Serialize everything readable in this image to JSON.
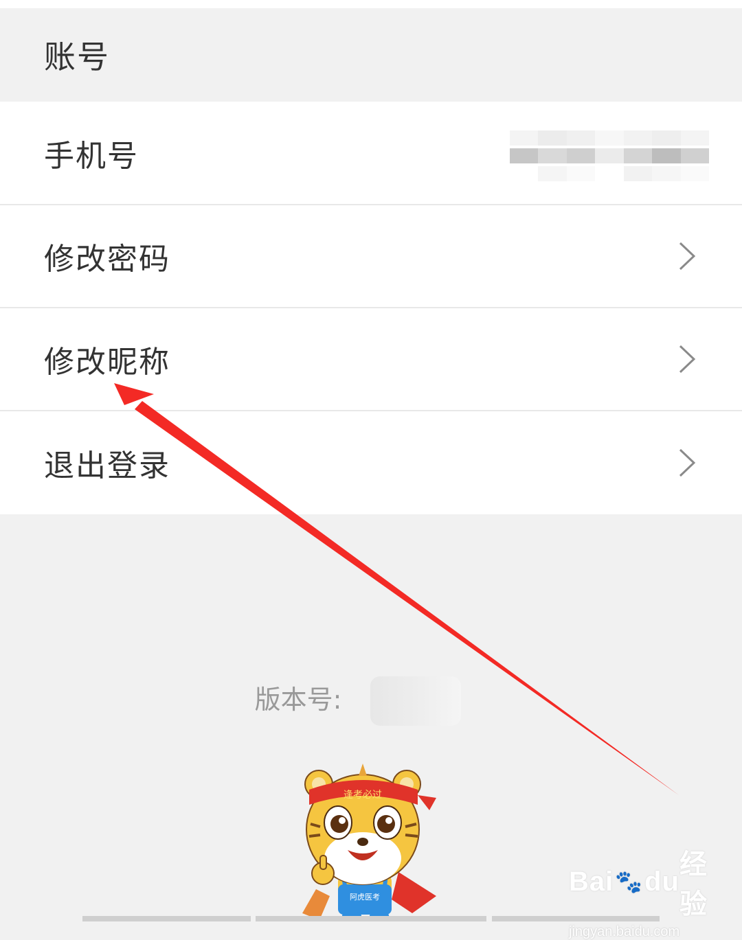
{
  "header": {
    "title": "账号"
  },
  "rows": [
    {
      "label": "手机号",
      "value": "",
      "has_chevron": false
    },
    {
      "label": "修改密码",
      "has_chevron": true
    },
    {
      "label": "修改昵称",
      "has_chevron": true
    },
    {
      "label": "退出登录",
      "has_chevron": true
    }
  ],
  "footer": {
    "version_label": "版本号:"
  },
  "mascot": {
    "headband_text": "逢考必过",
    "belly_text": "阿虎医考"
  },
  "watermark": {
    "brand": "Bai",
    "brand_suffix": "du",
    "product": "经验",
    "url": "jingyan.baidu.com"
  },
  "annotation": {
    "arrow_color": "#f32a25",
    "points_to": "修改昵称"
  },
  "icons": {
    "chevron": "chevron-right-icon"
  }
}
